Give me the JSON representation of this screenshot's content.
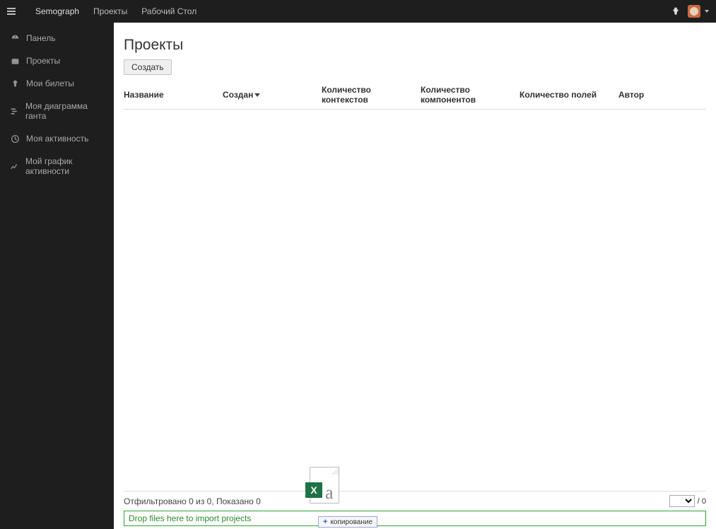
{
  "nav": {
    "brand": "Semograph",
    "links": [
      "Проекты",
      "Рабочий Стол"
    ]
  },
  "sidebar": {
    "items": [
      {
        "icon": "dashboard-icon",
        "label": "Панель"
      },
      {
        "icon": "briefcase-icon",
        "label": "Проекты"
      },
      {
        "icon": "pin-icon",
        "label": "Мои билеты"
      },
      {
        "icon": "gantt-icon",
        "label": "Моя диаграмма ганта"
      },
      {
        "icon": "clock-icon",
        "label": "Моя активность"
      },
      {
        "icon": "chart-icon",
        "label": "Мой график активности"
      }
    ]
  },
  "page": {
    "title": "Проекты",
    "create_btn": "Создать"
  },
  "table": {
    "columns": [
      "Название",
      "Создан",
      "Количество контекстов",
      "Количество компонентов",
      "Количество полей",
      "Автор"
    ],
    "sort_column_index": 1,
    "rows": []
  },
  "footer": {
    "status": "Отфильтровано 0 из 0, Показано 0",
    "page_total": "/ 0"
  },
  "dropzone": {
    "text": "Drop files here to import projects"
  },
  "drag": {
    "badge": "X",
    "letter": "a",
    "tooltip": "копирование"
  }
}
